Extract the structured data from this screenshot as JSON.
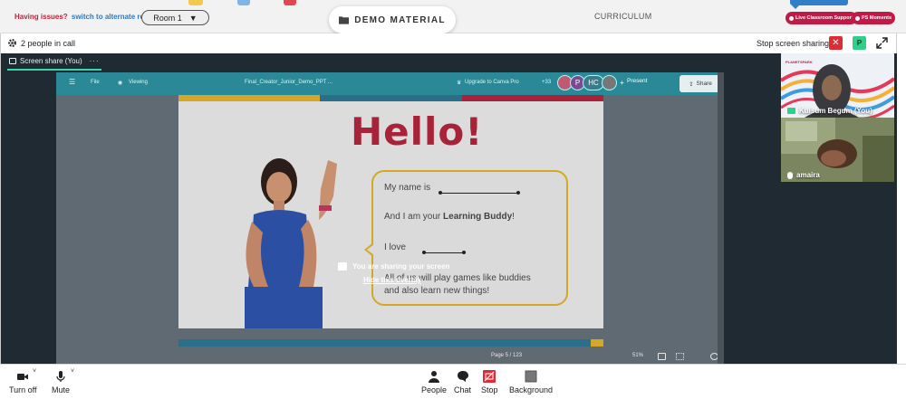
{
  "topbar": {
    "issues_label": "Having issues?",
    "alternate_room_link": "switch to alternate room",
    "room_select_value": "Room 1",
    "demo_material_label": "DEMO MATERIAL",
    "curriculum_label": "CURRICULUM",
    "live_support_label": "Live Classroom Support",
    "ps_moments_label": "PS Moments"
  },
  "callbar": {
    "people_count": "2 people in call",
    "stop_screen_sharing_label": "Stop screen sharing",
    "close_symbol": "✕",
    "p_badge": "P"
  },
  "share_tab": {
    "label": "Screen share (You)",
    "more": "···"
  },
  "canva": {
    "file_label": "File",
    "viewing_label": "Viewing",
    "doc_title": "Final_Creator_Junior_Demo_PPT ...",
    "upgrade_label": "Upgrade to Canva Pro",
    "collab_count": "+33",
    "avatar_letters": [
      "P",
      "HC"
    ],
    "plus": "+",
    "present_label": "Present",
    "share_label": "Share",
    "page_indicator": "Page 5 / 123",
    "zoom": "51%"
  },
  "slide": {
    "title": "Hello!",
    "line1": "My name is",
    "line2_prefix": "And I am your",
    "line2_bold": "Learning Buddy",
    "line2_suffix": "!",
    "line3": "I love",
    "line4": "All of us will play games like buddies",
    "line5": "and also learn new things!",
    "stripe_colors": [
      "#d4a826",
      "#2a6f8a",
      "#a8233a"
    ]
  },
  "overlay": {
    "message": "You are sharing your screen",
    "hide_link": "Hide this overlay"
  },
  "participants": [
    {
      "name": "Kulsum Begum (You)",
      "logo": "PLANETSPARK"
    },
    {
      "name": "amaira"
    }
  ],
  "toolbar": {
    "turn_off_label": "Turn off",
    "mute_label": "Mute",
    "people_label": "People",
    "chat_label": "Chat",
    "stop_label": "Stop",
    "background_label": "Background"
  },
  "colors": {
    "accent_red": "#c11a47",
    "share_green": "#2ed089",
    "stop_red": "#e02b35",
    "canva_teal": "#2b8897",
    "hello_maroon": "#a8233a"
  },
  "icons": [
    "folder-icon",
    "gear-icon",
    "expand-icon",
    "screen-share-icon",
    "camera-icon",
    "mic-icon",
    "people-icon",
    "chat-icon",
    "stop-share-icon",
    "background-icon"
  ]
}
